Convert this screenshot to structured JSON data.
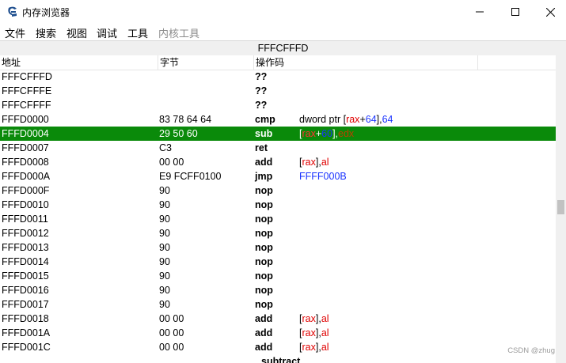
{
  "window": {
    "title": "内存浏览器"
  },
  "menu": [
    "文件",
    "搜索",
    "视图",
    "调试",
    "工具",
    "内核工具"
  ],
  "address_bar": "FFFCFFFD",
  "columns": {
    "address": "地址",
    "bytes": "字节",
    "opcode": "操作码"
  },
  "rows": [
    {
      "addr": "FFFCFFFD",
      "bytes": "",
      "op": "??",
      "args": []
    },
    {
      "addr": "FFFCFFFE",
      "bytes": "",
      "op": "??",
      "args": []
    },
    {
      "addr": "FFFCFFFF",
      "bytes": "",
      "op": "??",
      "args": []
    },
    {
      "addr": "FFFD0000",
      "bytes": "83 78 64 64",
      "op": "cmp",
      "args": [
        {
          "t": "dword ptr [",
          "c": "p"
        },
        {
          "t": "rax",
          "c": "r"
        },
        {
          "t": "+",
          "c": "p"
        },
        {
          "t": "64",
          "c": "n"
        },
        {
          "t": "],",
          "c": "p"
        },
        {
          "t": "64",
          "c": "n"
        }
      ]
    },
    {
      "addr": "FFFD0004",
      "bytes": "29 50 60",
      "op": "sub",
      "selected": true,
      "args": [
        {
          "t": "[",
          "c": "p"
        },
        {
          "t": "rax",
          "c": "r"
        },
        {
          "t": "+",
          "c": "p"
        },
        {
          "t": "60",
          "c": "n"
        },
        {
          "t": "],",
          "c": "p"
        },
        {
          "t": "edx",
          "c": "r2"
        }
      ]
    },
    {
      "addr": "FFFD0007",
      "bytes": "C3",
      "op": "ret",
      "args": []
    },
    {
      "addr": "FFFD0008",
      "bytes": "00 00",
      "op": "add",
      "args": [
        {
          "t": "[",
          "c": "p"
        },
        {
          "t": "rax",
          "c": "r"
        },
        {
          "t": "],",
          "c": "p"
        },
        {
          "t": "al",
          "c": "r"
        }
      ]
    },
    {
      "addr": "FFFD000A",
      "bytes": "E9 FCFF0100",
      "op": "jmp",
      "args": [
        {
          "t": "FFFF000B",
          "c": "n"
        }
      ]
    },
    {
      "addr": "FFFD000F",
      "bytes": "90",
      "op": "nop",
      "args": []
    },
    {
      "addr": "FFFD0010",
      "bytes": "90",
      "op": "nop",
      "args": []
    },
    {
      "addr": "FFFD0011",
      "bytes": "90",
      "op": "nop",
      "args": []
    },
    {
      "addr": "FFFD0012",
      "bytes": "90",
      "op": "nop",
      "args": []
    },
    {
      "addr": "FFFD0013",
      "bytes": "90",
      "op": "nop",
      "args": []
    },
    {
      "addr": "FFFD0014",
      "bytes": "90",
      "op": "nop",
      "args": []
    },
    {
      "addr": "FFFD0015",
      "bytes": "90",
      "op": "nop",
      "args": []
    },
    {
      "addr": "FFFD0016",
      "bytes": "90",
      "op": "nop",
      "args": []
    },
    {
      "addr": "FFFD0017",
      "bytes": "90",
      "op": "nop",
      "args": []
    },
    {
      "addr": "FFFD0018",
      "bytes": "00 00",
      "op": "add",
      "args": [
        {
          "t": "[",
          "c": "p"
        },
        {
          "t": "rax",
          "c": "r"
        },
        {
          "t": "],",
          "c": "p"
        },
        {
          "t": "al",
          "c": "r"
        }
      ]
    },
    {
      "addr": "FFFD001A",
      "bytes": "00 00",
      "op": "add",
      "args": [
        {
          "t": "[",
          "c": "p"
        },
        {
          "t": "rax",
          "c": "r"
        },
        {
          "t": "],",
          "c": "p"
        },
        {
          "t": "al",
          "c": "r"
        }
      ]
    },
    {
      "addr": "FFFD001C",
      "bytes": "00 00",
      "op": "add",
      "args": [
        {
          "t": "[",
          "c": "p"
        },
        {
          "t": "rax",
          "c": "r"
        },
        {
          "t": "],",
          "c": "p"
        },
        {
          "t": "al",
          "c": "r"
        }
      ]
    }
  ],
  "partial_row": {
    "op": "subtract"
  },
  "watermark": "CSDN @zhug",
  "colors": {
    "selected_row": "#0a8a0a",
    "register": "#e00000",
    "number": "#1a33ff"
  },
  "icons": [
    "app-icon",
    "minimize-icon",
    "maximize-icon",
    "close-icon"
  ]
}
